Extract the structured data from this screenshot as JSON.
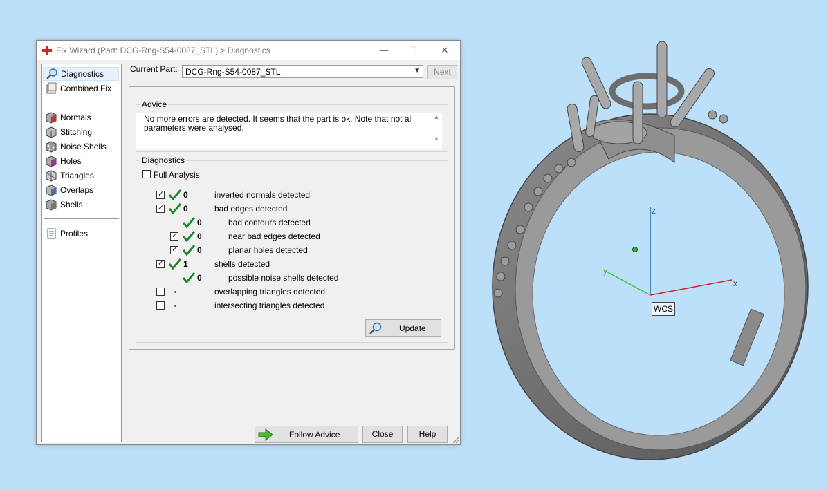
{
  "window": {
    "title": "Fix Wizard (Part: DCG-Rng-S54-0087_STL) > Diagnostics",
    "minimize": "—",
    "maximize": "☐",
    "close": "✕"
  },
  "nav": {
    "items": [
      {
        "label": "Diagnostics",
        "icon": "magnifier-icon"
      },
      {
        "label": "Combined Fix",
        "icon": "combined-fix-icon"
      },
      {
        "label": "Normals",
        "icon": "normals-cube-icon"
      },
      {
        "label": "Stitching",
        "icon": "stitching-cube-icon"
      },
      {
        "label": "Noise Shells",
        "icon": "noise-shells-cube-icon"
      },
      {
        "label": "Holes",
        "icon": "holes-cube-icon"
      },
      {
        "label": "Triangles",
        "icon": "triangles-cube-icon"
      },
      {
        "label": "Overlaps",
        "icon": "overlaps-cube-icon"
      },
      {
        "label": "Shells",
        "icon": "shells-cube-icon"
      },
      {
        "label": "Profiles",
        "icon": "profiles-document-icon"
      }
    ]
  },
  "current_part": {
    "label": "Current Part:",
    "value": "DCG-Rng-S54-0087_STL",
    "next": "Next"
  },
  "advice": {
    "title": "Advice",
    "text": "No more errors are detected. It seems that the part is ok. Note that not all parameters were analysed."
  },
  "diagnostics": {
    "title": "Diagnostics",
    "full_analysis": "Full Analysis",
    "rows": [
      {
        "checked": true,
        "ok": true,
        "value": "0",
        "label": "inverted normals detected"
      },
      {
        "checked": true,
        "ok": true,
        "value": "0",
        "label": "bad edges detected"
      },
      {
        "checked": null,
        "ok": true,
        "value": "0",
        "label": "bad contours detected"
      },
      {
        "checked": true,
        "ok": true,
        "value": "0",
        "label": "near bad edges detected"
      },
      {
        "checked": true,
        "ok": true,
        "value": "0",
        "label": "planar holes detected"
      },
      {
        "checked": true,
        "ok": true,
        "value": "1",
        "label": "shells detected"
      },
      {
        "checked": null,
        "ok": true,
        "value": "0",
        "label": "possible noise shells detected"
      },
      {
        "checked": false,
        "ok": false,
        "value": "",
        "label": "overlapping triangles detected"
      },
      {
        "checked": false,
        "ok": false,
        "value": "",
        "label": "intersecting triangles detected"
      }
    ],
    "update": "Update"
  },
  "footer": {
    "follow_advice": "Follow Advice",
    "close": "Close",
    "help": "Help"
  },
  "viewport": {
    "axis_x": "x",
    "axis_y": "y",
    "axis_z": "z",
    "wcs": "WCS"
  },
  "colors": {
    "background": "#bde0fa",
    "check_green": "#1a8a2a",
    "axis_x": "#cc2222",
    "axis_y": "#33cc33",
    "axis_z": "#2266cc"
  }
}
